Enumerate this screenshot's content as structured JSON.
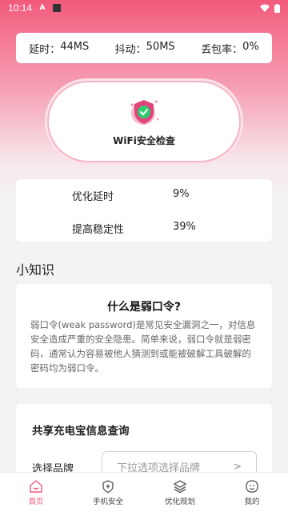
{
  "statusbar": {
    "time": "10:14",
    "a_icon": "A"
  },
  "stats": {
    "latency_label": "延时：",
    "latency_value": "44MS",
    "jitter_label": "抖动：",
    "jitter_value": "50MS",
    "loss_label": "丢包率：",
    "loss_value": "0%"
  },
  "check": {
    "label": "WiFi安全检查"
  },
  "optimize": [
    {
      "label": "优化延时",
      "value": "9%"
    },
    {
      "label": "提高稳定性",
      "value": "39%"
    }
  ],
  "knowledge": {
    "section_title": "小知识",
    "title": "什么是弱口令?",
    "body": "弱口令(weak password)是常见安全漏洞之一，对信息安全造成严重的安全隐患。简单来说，弱口令就是弱密码，通常认为容易被他人猜测到或能被破解工具破解的密码均为弱口令。"
  },
  "query": {
    "title": "共享充电宝信息查询",
    "brand_label": "选择品牌",
    "brand_placeholder": "下拉选项选择品牌",
    "chevron": ">"
  },
  "tabs": [
    {
      "label": "首页",
      "icon": "home-icon",
      "active": true
    },
    {
      "label": "手机安全",
      "icon": "shield-plus-icon",
      "active": false
    },
    {
      "label": "优化规划",
      "icon": "layers-icon",
      "active": false
    },
    {
      "label": "我的",
      "icon": "smile-icon",
      "active": false
    }
  ],
  "colors": {
    "accent": "#f25a7c",
    "shield": "#e0457b",
    "check_green": "#2ecc71"
  }
}
